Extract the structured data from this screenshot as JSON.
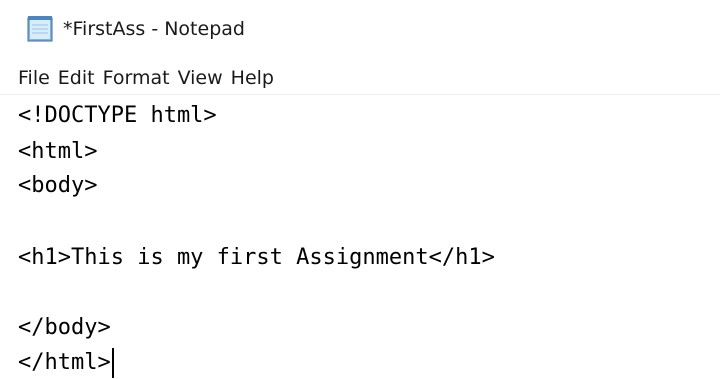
{
  "window": {
    "title": "*FirstAss - Notepad",
    "app_icon": "notepad-icon"
  },
  "menu": {
    "items": [
      "File",
      "Edit",
      "Format",
      "View",
      "Help"
    ]
  },
  "editor": {
    "lines": [
      "<!DOCTYPE html>",
      "<html>",
      "<body>",
      "",
      "<h1>This is my first Assignment</h1>",
      "",
      "</body>",
      "</html>"
    ]
  }
}
